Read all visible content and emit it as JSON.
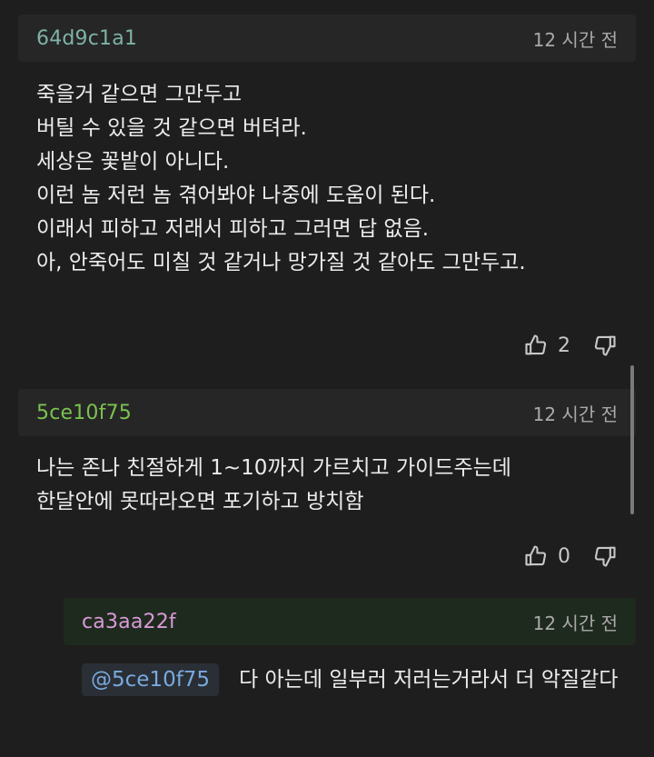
{
  "comments": [
    {
      "author": "64d9c1a1",
      "time": "12 시간 전",
      "lines": [
        "죽을거 같으면 그만두고",
        "버틸 수 있을 것 같으면 버텨라.",
        "세상은 꽃밭이 아니다.",
        "이런 놈 저런 놈 겪어봐야 나중에 도움이 된다.",
        "이래서 피하고 저래서 피하고 그러면 답 없음.",
        "아, 안죽어도 미칠 것 같거나 망가질 것 같아도 그만두고."
      ],
      "likes": "2"
    },
    {
      "author": "5ce10f75",
      "time": "12 시간 전",
      "lines": [
        "나는 존나 친절하게 1~10까지 가르치고 가이드주는데",
        "한달안에 못따라오면 포기하고 방치함"
      ],
      "likes": "0"
    },
    {
      "author": "ca3aa22f",
      "time": "12 시간 전",
      "mention": "@5ce10f75",
      "text": "다 아는데 일부러 저러는거라서 더 악질같다"
    }
  ],
  "icons": {
    "like": "thumbs-up-icon",
    "dislike": "thumbs-down-icon"
  },
  "colors": {
    "background": "#1e1e1e",
    "header": "#262626",
    "reply_header": "#1f2a1f",
    "author1": "#7fb2a7",
    "author2": "#7bc24f",
    "author3": "#d99ad6",
    "mention": "#79a9dd"
  }
}
